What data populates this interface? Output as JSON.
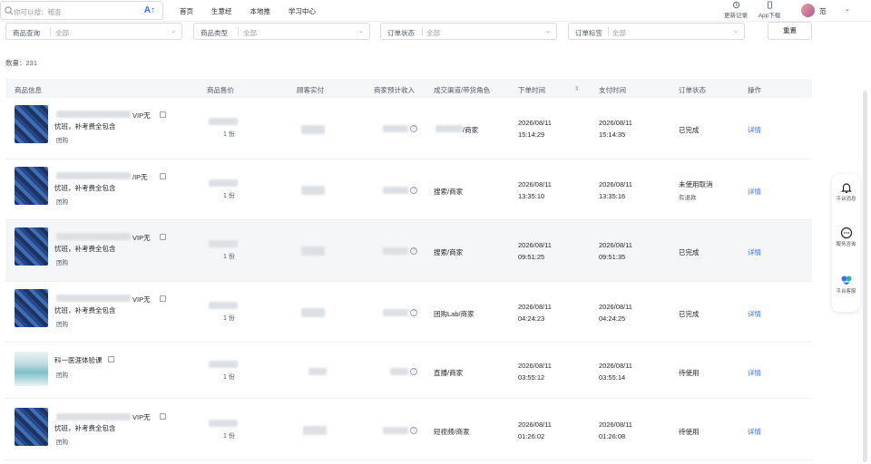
{
  "search": {
    "placeholder": "你可以搜：稽查",
    "ai_label": "A↑"
  },
  "nav": [
    "首页",
    "生意经",
    "本地推",
    "学习中心"
  ],
  "tools": {
    "updates": "更新记录",
    "app": "App下载"
  },
  "user": {
    "name": "范"
  },
  "filters": [
    {
      "label": "商品查询",
      "value": "全部"
    },
    {
      "label": "商品类型",
      "value": "全部"
    },
    {
      "label": "订单状态",
      "value": "全部"
    },
    {
      "label": "订单标签",
      "value": "全部"
    }
  ],
  "reset_label": "重置",
  "count_text": "数量：231",
  "columns": [
    "商品信息",
    "商品售价",
    "顾客实付",
    "商家预计收入",
    "成交渠道/带货角色",
    "下单时间",
    "支付时间",
    "订单状态",
    "操作"
  ],
  "sort_icon": "⇕",
  "qty_text": "1 份",
  "action_label": "详情",
  "float_panel": {
    "items": [
      "平台消息",
      "服务咨询",
      "平台客服"
    ]
  },
  "rows": [
    {
      "line1_tail": "VIP无",
      "line2": "忧班，补考费全包含",
      "type": "团购",
      "channel": "/商家",
      "order_date": "2026/08/11",
      "order_time": "15:14:29",
      "pay_date": "2026/08/11",
      "pay_time": "15:14:35",
      "status": "已完成",
      "status2": ""
    },
    {
      "line1_tail": "/IP无",
      "line2": "忧班，补考费全包含",
      "type": "团购",
      "channel": "搜索/商家",
      "order_date": "2026/08/11",
      "order_time": "13:35:10",
      "pay_date": "2026/08/11",
      "pay_time": "13:35:16",
      "status": "未使用取消",
      "status2": "有退款"
    },
    {
      "line1_tail": "VIP无",
      "line2": "忧班，补考费全包含",
      "type": "团购",
      "channel": "搜索/商家",
      "order_date": "2026/08/11",
      "order_time": "09:51:25",
      "pay_date": "2026/08/11",
      "pay_time": "09:51:35",
      "status": "已完成",
      "status2": ""
    },
    {
      "line1_tail": "VIP无",
      "line2": "忧班，补考费全包含",
      "type": "团购",
      "channel": "团购Lab/商家",
      "order_date": "2026/08/11",
      "order_time": "04:24:23",
      "pay_date": "2026/08/11",
      "pay_time": "04:24:25",
      "status": "已完成",
      "status2": ""
    },
    {
      "line1_tail": "科一医涯体验课",
      "line2": "",
      "type": "团购",
      "channel": "直播/商家",
      "order_date": "2026/08/11",
      "order_time": "03:55:12",
      "pay_date": "2026/08/11",
      "pay_time": "03:55:14",
      "status": "待使用",
      "status2": ""
    },
    {
      "line1_tail": "VIP无",
      "line2": "忧班，补考费全包含",
      "type": "团购",
      "channel": "短视频/商家",
      "order_date": "2026/08/11",
      "order_time": "01:26:02",
      "pay_date": "2026/08/11",
      "pay_time": "01:26:08",
      "status": "待使用",
      "status2": ""
    }
  ]
}
